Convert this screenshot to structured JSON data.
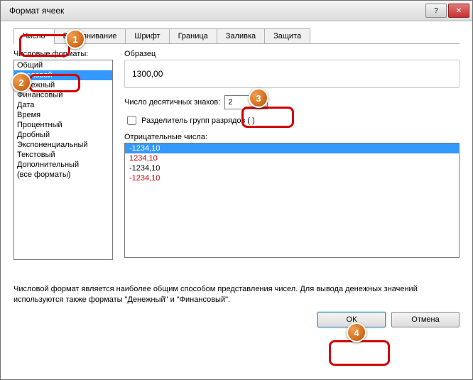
{
  "window": {
    "title": "Формат ячеек"
  },
  "tabs": [
    "Число",
    "Выравнивание",
    "Шрифт",
    "Граница",
    "Заливка",
    "Защита"
  ],
  "category_label": "Числовые форматы:",
  "categories": [
    "Общий",
    "Числовой",
    "Денежный",
    "Финансовый",
    "Дата",
    "Время",
    "Процентный",
    "Дробный",
    "Экспоненциальный",
    "Текстовый",
    "Дополнительный",
    "(все форматы)"
  ],
  "selected_category": 1,
  "sample_label": "Образец",
  "sample_value": "1300,00",
  "decimal_label": "Число десятичных знаков:",
  "decimal_value": "2",
  "separator_label": "Разделитель групп разрядов ( )",
  "negative_label": "Отрицательные числа:",
  "negatives": [
    {
      "text": "-1234,10",
      "cls": "sel"
    },
    {
      "text": "1234,10",
      "cls": "red"
    },
    {
      "text": "-1234,10",
      "cls": ""
    },
    {
      "text": "-1234,10",
      "cls": "red"
    }
  ],
  "description": "Числовой формат является наиболее общим способом представления чисел. Для вывода денежных значений используются также форматы \"Денежный\" и \"Финансовый\".",
  "buttons": {
    "ok": "ОК",
    "cancel": "Отмена"
  },
  "callouts": [
    "1",
    "2",
    "3",
    "4"
  ]
}
